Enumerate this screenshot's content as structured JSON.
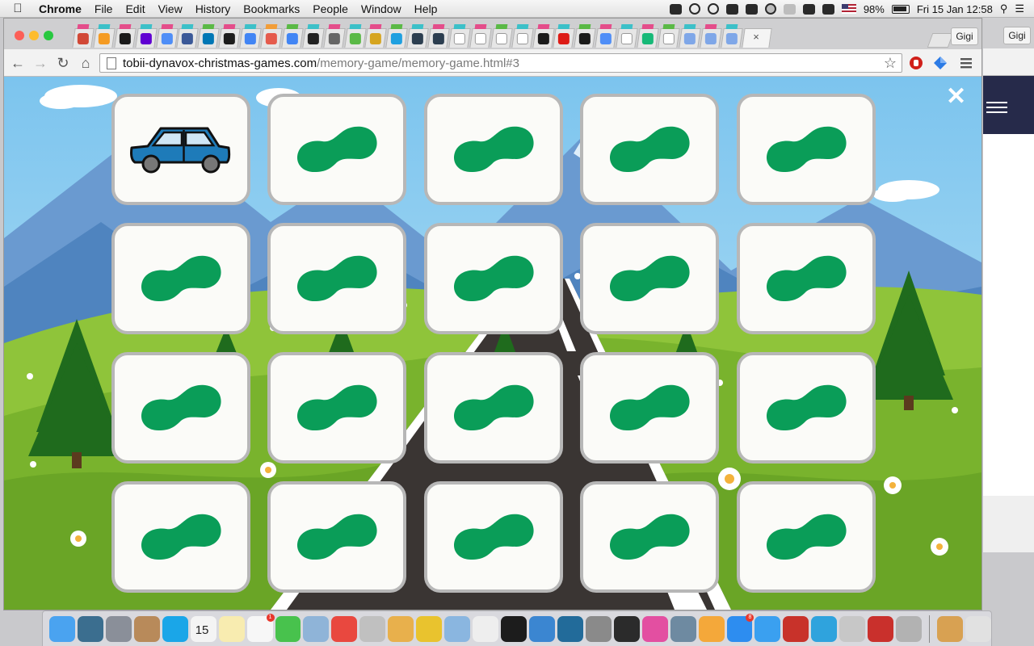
{
  "menubar": {
    "app_name": "Chrome",
    "menus": [
      "File",
      "Edit",
      "View",
      "History",
      "Bookmarks",
      "People",
      "Window",
      "Help"
    ],
    "battery": "98%",
    "datetime": "Fri 15 Jan  12:58"
  },
  "browser": {
    "profile_name": "Gigi",
    "url_domain": "tobii-dynavox-christmas-games.com",
    "url_path": "/memory-game/memory-game.html#3",
    "tabs": [
      {
        "fav": "#d14836",
        "stripe": "#e44d8a"
      },
      {
        "fav": "#f59b23",
        "stripe": "#3cc0c8"
      },
      {
        "fav": "#1b1b1b",
        "stripe": "#e44d8a"
      },
      {
        "fav": "#6001d2",
        "stripe": "#3cc0c8"
      },
      {
        "fav": "#4f8ef7",
        "stripe": "#e44d8a"
      },
      {
        "fav": "#3b5998",
        "stripe": "#3cc0c8"
      },
      {
        "fav": "#0077b5",
        "stripe": "#5ab946"
      },
      {
        "fav": "#1d1d1d",
        "stripe": "#e44d8a"
      },
      {
        "fav": "#4285f4",
        "stripe": "#3cc0c8"
      },
      {
        "fav": "#e55b4d",
        "stripe": "#f29d38"
      },
      {
        "fav": "#4285f4",
        "stripe": "#5ab946"
      },
      {
        "fav": "#222222",
        "stripe": "#3cc0c8"
      },
      {
        "fav": "#666666",
        "stripe": "#e44d8a"
      },
      {
        "fav": "#5ab946",
        "stripe": "#3cc0c8"
      },
      {
        "fav": "#d6a520",
        "stripe": "#e44d8a"
      },
      {
        "fav": "#1fa0e0",
        "stripe": "#5ab946"
      },
      {
        "fav": "#2c3e50",
        "stripe": "#3cc0c8"
      },
      {
        "fav": "#2c3e50",
        "stripe": "#e44d8a"
      },
      {
        "fav": "#ffffff",
        "stripe": "#3cc0c8"
      },
      {
        "fav": "#ffffff",
        "stripe": "#e44d8a"
      },
      {
        "fav": "#ffffff",
        "stripe": "#5ab946"
      },
      {
        "fav": "#ffffff",
        "stripe": "#3cc0c8"
      },
      {
        "fav": "#1b1b1b",
        "stripe": "#e44d8a"
      },
      {
        "fav": "#dd1b16",
        "stripe": "#3cc0c8"
      },
      {
        "fav": "#1b1b1b",
        "stripe": "#5ab946"
      },
      {
        "fav": "#4f8ef7",
        "stripe": "#e44d8a"
      },
      {
        "fav": "#ffffff",
        "stripe": "#3cc0c8"
      },
      {
        "fav": "#17b978",
        "stripe": "#e44d8a"
      },
      {
        "fav": "#ffffff",
        "stripe": "#5ab946"
      },
      {
        "fav": "#7fa7e8",
        "stripe": "#3cc0c8"
      },
      {
        "fav": "#7fa7e8",
        "stripe": "#e44d8a"
      },
      {
        "fav": "#7fa7e8",
        "stripe": "#3cc0c8"
      }
    ]
  },
  "game": {
    "close_icon": "close-icon",
    "card_back_color": "#0a9d58",
    "card_border_color": "#b7b7b7",
    "revealed_card": {
      "row": 0,
      "col": 0,
      "picture": "car",
      "car_color": "#1e7bb9"
    },
    "rows": 4,
    "cols": 5
  },
  "dock": {
    "apps": [
      {
        "name": "finder",
        "color": "#4aa3f0"
      },
      {
        "name": "dashboard",
        "color": "#3b6e8f"
      },
      {
        "name": "launchpad",
        "color": "#8a8f99"
      },
      {
        "name": "contacts",
        "color": "#b88a5a"
      },
      {
        "name": "skype",
        "color": "#1aa6e8"
      },
      {
        "name": "calendar",
        "color": "#f4f4f4",
        "text": "15"
      },
      {
        "name": "notes",
        "color": "#f8ecb0"
      },
      {
        "name": "reminders",
        "color": "#f7f7f7",
        "badge": "1"
      },
      {
        "name": "facetime",
        "color": "#48c24d"
      },
      {
        "name": "preview",
        "color": "#8fb4d8"
      },
      {
        "name": "chrome",
        "color": "#e9483f"
      },
      {
        "name": "image-capture",
        "color": "#c0c0c0"
      },
      {
        "name": "grapher",
        "color": "#e8b04c"
      },
      {
        "name": "wunderlist",
        "color": "#e9c32e"
      },
      {
        "name": "virtualbox",
        "color": "#8ab6e0"
      },
      {
        "name": "github-desktop",
        "color": "#eeeeee"
      },
      {
        "name": "terminal",
        "color": "#1c1c1c"
      },
      {
        "name": "xcode",
        "color": "#3b86d1"
      },
      {
        "name": "sourcetree",
        "color": "#226b9a"
      },
      {
        "name": "system-preferences",
        "color": "#8a8a8a"
      },
      {
        "name": "activity-monitor",
        "color": "#2b2b2b"
      },
      {
        "name": "itunes",
        "color": "#e34fa1"
      },
      {
        "name": "photos-viewer",
        "color": "#6e8aa1"
      },
      {
        "name": "photos",
        "color": "#f4a83a"
      },
      {
        "name": "app-store",
        "color": "#2d8df0",
        "badge": "8"
      },
      {
        "name": "safari",
        "color": "#3aa0f0"
      },
      {
        "name": "filezilla",
        "color": "#c8322a"
      },
      {
        "name": "telegram",
        "color": "#2fa3dd"
      },
      {
        "name": "transporter",
        "color": "#c7c7c7"
      },
      {
        "name": "zotero",
        "color": "#c9302c"
      },
      {
        "name": "keychain",
        "color": "#b2b2b2"
      },
      {
        "name": "downloads",
        "color": "#d8a152"
      },
      {
        "name": "trash",
        "color": "#e1e1e1"
      }
    ]
  }
}
